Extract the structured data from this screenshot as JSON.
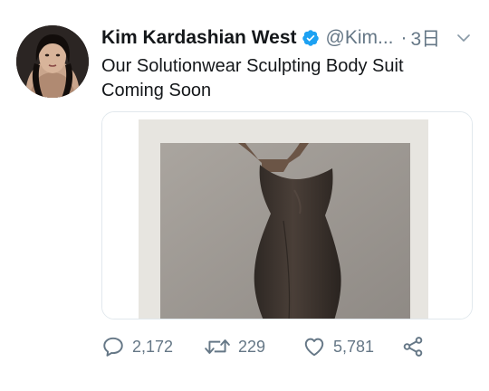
{
  "tweet": {
    "author": {
      "name": "Kim Kardashian West",
      "handle": "@Kim...",
      "verified": true
    },
    "separator": "·",
    "timestamp": "3日",
    "text_lines": [
      "Our Solutionwear Sculpting Body Suit",
      "Coming Soon"
    ]
  },
  "actions": {
    "reply_count": "2,172",
    "retweet_count": "229",
    "like_count": "5,781"
  },
  "icons": {
    "verified": "verified-badge-icon",
    "more": "chevron-down-icon",
    "reply": "reply-icon",
    "retweet": "retweet-icon",
    "like": "heart-icon",
    "share": "share-icon"
  },
  "colors": {
    "verified_blue": "#1da1f2",
    "secondary_text": "#657786",
    "primary_text": "#14171a"
  }
}
